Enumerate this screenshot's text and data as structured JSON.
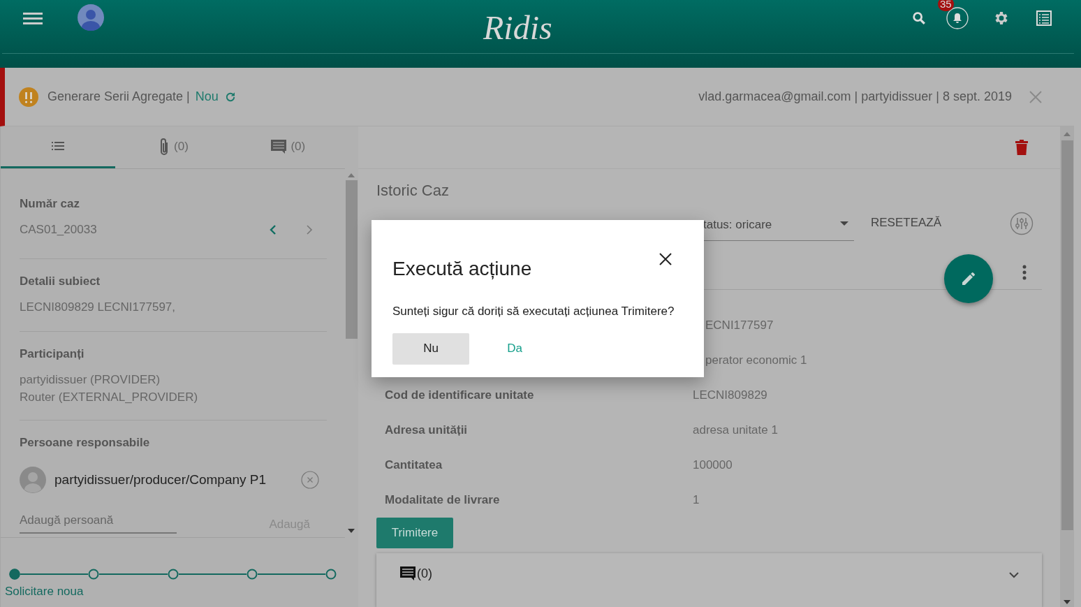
{
  "header": {
    "logo": "Ridis",
    "notification_count": "35"
  },
  "case_bar": {
    "title": "Generare Serii Agregate |",
    "status": "Nou",
    "meta": "vlad.garmacea@gmail.com | partyidissuer | 8 sept. 2019"
  },
  "left_tabs": [
    {
      "kind": "details",
      "selected": true
    },
    {
      "kind": "attachments",
      "count": "(0)",
      "selected": false
    },
    {
      "kind": "comments",
      "count": "(0)",
      "selected": false
    }
  ],
  "case_number": {
    "label": "Număr caz",
    "value": "CAS01_20033",
    "nav": [
      {
        "kind": "prev",
        "disabled": false
      },
      {
        "kind": "next",
        "disabled": true
      }
    ]
  },
  "subject": {
    "label": "Detalii subiect",
    "value": "LECNI809829 LECNI177597,"
  },
  "participants": {
    "label": "Participanți",
    "lines": [
      "partyidissuer (PROVIDER)",
      "Router (EXTERNAL_PROVIDER)"
    ]
  },
  "responsible": {
    "label": "Persoane responsabile",
    "people": [
      "partyidissuer/producer/Company P1"
    ],
    "add_field": {
      "placeholder": "Adaugă persoană"
    },
    "add_button": {
      "label": "Adaugă",
      "disabled": true
    }
  },
  "stepper": {
    "steps": [
      {
        "label": "Solicitare noua",
        "selected": true
      },
      {
        "selected": false
      },
      {
        "selected": false
      },
      {
        "selected": false
      },
      {
        "selected": false
      }
    ]
  },
  "history": {
    "title": "Istoric Caz",
    "status_select": "tatus: oricare",
    "reset": "RESETEAZĂ"
  },
  "details_rows": [
    {
      "value": "ECNI177597"
    },
    {
      "value": "perator economic 1"
    },
    {
      "label": "Cod de identificare unitate",
      "value": "LECNI809829"
    },
    {
      "label": "Adresa unității",
      "value": "adresa unitate 1"
    },
    {
      "label": "Cantitatea",
      "value": "100000"
    },
    {
      "label": "Modalitate de livrare",
      "value": "1"
    }
  ],
  "submit_button": "Trimitere",
  "comments_panel": {
    "count": "(0)",
    "expanded": false
  },
  "dialog": {
    "title": "Execută acțiune",
    "message": "Sunteți sigur că doriți să executați acțiunea Trimitere?",
    "buttons": [
      {
        "label": "Nu",
        "kind": "secondary"
      },
      {
        "label": "Da",
        "kind": "primary"
      }
    ]
  }
}
